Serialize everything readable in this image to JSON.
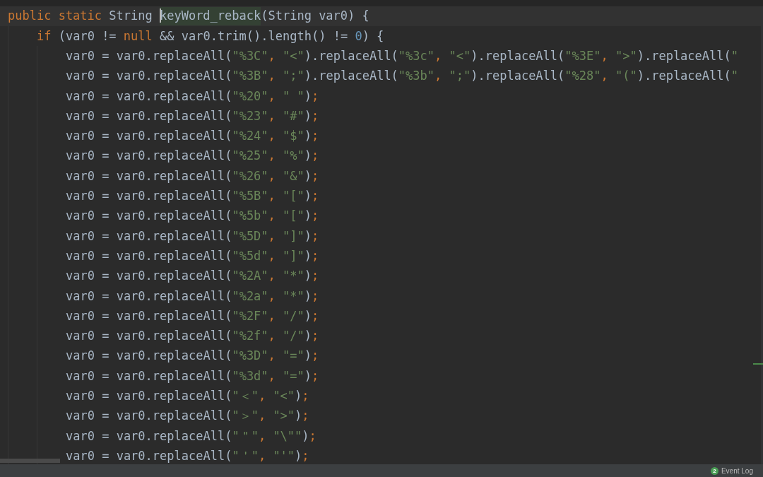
{
  "editor": {
    "lines": [
      {
        "segments": [
          {
            "kind": "keyword",
            "text": "public static "
          },
          {
            "kind": "plain",
            "text": "String "
          },
          {
            "kind": "match",
            "text": "keyWord_reback",
            "caret": true
          },
          {
            "kind": "plain",
            "text": "(String var0) {"
          }
        ],
        "children": [
          {
            "segments": [
              {
                "kind": "keyword",
                "text": "if "
              },
              {
                "kind": "plain",
                "text": "(var0 != "
              },
              {
                "kind": "keyword",
                "text": "null "
              },
              {
                "kind": "plain",
                "text": "&& var0.trim().length() != "
              },
              {
                "kind": "number",
                "text": "0"
              },
              {
                "kind": "plain",
                "text": ") {"
              }
            ],
            "children": [
              {
                "segments": [
                  {
                    "kind": "plain",
                    "text": "var0 = var0.replaceAll("
                  },
                  {
                    "kind": "string",
                    "text": "\"%3C\""
                  },
                  {
                    "kind": "punct",
                    "text": ", "
                  },
                  {
                    "kind": "string",
                    "text": "\"<\""
                  },
                  {
                    "kind": "plain",
                    "text": ").replaceAll("
                  },
                  {
                    "kind": "string",
                    "text": "\"%3c\""
                  },
                  {
                    "kind": "punct",
                    "text": ", "
                  },
                  {
                    "kind": "string",
                    "text": "\"<\""
                  },
                  {
                    "kind": "plain",
                    "text": ").replaceAll("
                  },
                  {
                    "kind": "string",
                    "text": "\"%3E\""
                  },
                  {
                    "kind": "punct",
                    "text": ", "
                  },
                  {
                    "kind": "string",
                    "text": "\">\""
                  },
                  {
                    "kind": "plain",
                    "text": ").replaceAll("
                  },
                  {
                    "kind": "string",
                    "text": "\""
                  }
                ]
              },
              {
                "segments": [
                  {
                    "kind": "plain",
                    "text": "var0 = var0.replaceAll("
                  },
                  {
                    "kind": "string",
                    "text": "\"%3B\""
                  },
                  {
                    "kind": "punct",
                    "text": ", "
                  },
                  {
                    "kind": "string",
                    "text": "\";\""
                  },
                  {
                    "kind": "plain",
                    "text": ").replaceAll("
                  },
                  {
                    "kind": "string",
                    "text": "\"%3b\""
                  },
                  {
                    "kind": "punct",
                    "text": ", "
                  },
                  {
                    "kind": "string",
                    "text": "\";\""
                  },
                  {
                    "kind": "plain",
                    "text": ").replaceAll("
                  },
                  {
                    "kind": "string",
                    "text": "\"%28\""
                  },
                  {
                    "kind": "punct",
                    "text": ", "
                  },
                  {
                    "kind": "string",
                    "text": "\"(\""
                  },
                  {
                    "kind": "plain",
                    "text": ").replaceAll("
                  },
                  {
                    "kind": "string",
                    "text": "\""
                  }
                ]
              },
              {
                "segments": [
                  {
                    "kind": "plain",
                    "text": "var0 = var0.replaceAll("
                  },
                  {
                    "kind": "string",
                    "text": "\"%20\""
                  },
                  {
                    "kind": "punct",
                    "text": ", "
                  },
                  {
                    "kind": "string",
                    "text": "\" \""
                  },
                  {
                    "kind": "plain",
                    "text": ")"
                  },
                  {
                    "kind": "punct",
                    "text": ";"
                  }
                ]
              },
              {
                "segments": [
                  {
                    "kind": "plain",
                    "text": "var0 = var0.replaceAll("
                  },
                  {
                    "kind": "string",
                    "text": "\"%23\""
                  },
                  {
                    "kind": "punct",
                    "text": ", "
                  },
                  {
                    "kind": "string",
                    "text": "\"#\""
                  },
                  {
                    "kind": "plain",
                    "text": ")"
                  },
                  {
                    "kind": "punct",
                    "text": ";"
                  }
                ]
              },
              {
                "segments": [
                  {
                    "kind": "plain",
                    "text": "var0 = var0.replaceAll("
                  },
                  {
                    "kind": "string",
                    "text": "\"%24\""
                  },
                  {
                    "kind": "punct",
                    "text": ", "
                  },
                  {
                    "kind": "string",
                    "text": "\"$\""
                  },
                  {
                    "kind": "plain",
                    "text": ")"
                  },
                  {
                    "kind": "punct",
                    "text": ";"
                  }
                ]
              },
              {
                "segments": [
                  {
                    "kind": "plain",
                    "text": "var0 = var0.replaceAll("
                  },
                  {
                    "kind": "string",
                    "text": "\"%25\""
                  },
                  {
                    "kind": "punct",
                    "text": ", "
                  },
                  {
                    "kind": "string",
                    "text": "\"%\""
                  },
                  {
                    "kind": "plain",
                    "text": ")"
                  },
                  {
                    "kind": "punct",
                    "text": ";"
                  }
                ]
              },
              {
                "segments": [
                  {
                    "kind": "plain",
                    "text": "var0 = var0.replaceAll("
                  },
                  {
                    "kind": "string",
                    "text": "\"%26\""
                  },
                  {
                    "kind": "punct",
                    "text": ", "
                  },
                  {
                    "kind": "string",
                    "text": "\"&\""
                  },
                  {
                    "kind": "plain",
                    "text": ")"
                  },
                  {
                    "kind": "punct",
                    "text": ";"
                  }
                ]
              },
              {
                "segments": [
                  {
                    "kind": "plain",
                    "text": "var0 = var0.replaceAll("
                  },
                  {
                    "kind": "string",
                    "text": "\"%5B\""
                  },
                  {
                    "kind": "punct",
                    "text": ", "
                  },
                  {
                    "kind": "string",
                    "text": "\"[\""
                  },
                  {
                    "kind": "plain",
                    "text": ")"
                  },
                  {
                    "kind": "punct",
                    "text": ";"
                  }
                ]
              },
              {
                "segments": [
                  {
                    "kind": "plain",
                    "text": "var0 = var0.replaceAll("
                  },
                  {
                    "kind": "string",
                    "text": "\"%5b\""
                  },
                  {
                    "kind": "punct",
                    "text": ", "
                  },
                  {
                    "kind": "string",
                    "text": "\"[\""
                  },
                  {
                    "kind": "plain",
                    "text": ")"
                  },
                  {
                    "kind": "punct",
                    "text": ";"
                  }
                ]
              },
              {
                "segments": [
                  {
                    "kind": "plain",
                    "text": "var0 = var0.replaceAll("
                  },
                  {
                    "kind": "string",
                    "text": "\"%5D\""
                  },
                  {
                    "kind": "punct",
                    "text": ", "
                  },
                  {
                    "kind": "string",
                    "text": "\"]\""
                  },
                  {
                    "kind": "plain",
                    "text": ")"
                  },
                  {
                    "kind": "punct",
                    "text": ";"
                  }
                ]
              },
              {
                "segments": [
                  {
                    "kind": "plain",
                    "text": "var0 = var0.replaceAll("
                  },
                  {
                    "kind": "string",
                    "text": "\"%5d\""
                  },
                  {
                    "kind": "punct",
                    "text": ", "
                  },
                  {
                    "kind": "string",
                    "text": "\"]\""
                  },
                  {
                    "kind": "plain",
                    "text": ")"
                  },
                  {
                    "kind": "punct",
                    "text": ";"
                  }
                ]
              },
              {
                "segments": [
                  {
                    "kind": "plain",
                    "text": "var0 = var0.replaceAll("
                  },
                  {
                    "kind": "string",
                    "text": "\"%2A\""
                  },
                  {
                    "kind": "punct",
                    "text": ", "
                  },
                  {
                    "kind": "string",
                    "text": "\"*\""
                  },
                  {
                    "kind": "plain",
                    "text": ")"
                  },
                  {
                    "kind": "punct",
                    "text": ";"
                  }
                ]
              },
              {
                "segments": [
                  {
                    "kind": "plain",
                    "text": "var0 = var0.replaceAll("
                  },
                  {
                    "kind": "string",
                    "text": "\"%2a\""
                  },
                  {
                    "kind": "punct",
                    "text": ", "
                  },
                  {
                    "kind": "string",
                    "text": "\"*\""
                  },
                  {
                    "kind": "plain",
                    "text": ")"
                  },
                  {
                    "kind": "punct",
                    "text": ";"
                  }
                ]
              },
              {
                "segments": [
                  {
                    "kind": "plain",
                    "text": "var0 = var0.replaceAll("
                  },
                  {
                    "kind": "string",
                    "text": "\"%2F\""
                  },
                  {
                    "kind": "punct",
                    "text": ", "
                  },
                  {
                    "kind": "string",
                    "text": "\"/\""
                  },
                  {
                    "kind": "plain",
                    "text": ")"
                  },
                  {
                    "kind": "punct",
                    "text": ";"
                  }
                ]
              },
              {
                "segments": [
                  {
                    "kind": "plain",
                    "text": "var0 = var0.replaceAll("
                  },
                  {
                    "kind": "string",
                    "text": "\"%2f\""
                  },
                  {
                    "kind": "punct",
                    "text": ", "
                  },
                  {
                    "kind": "string",
                    "text": "\"/\""
                  },
                  {
                    "kind": "plain",
                    "text": ")"
                  },
                  {
                    "kind": "punct",
                    "text": ";"
                  }
                ]
              },
              {
                "segments": [
                  {
                    "kind": "plain",
                    "text": "var0 = var0.replaceAll("
                  },
                  {
                    "kind": "string",
                    "text": "\"%3D\""
                  },
                  {
                    "kind": "punct",
                    "text": ", "
                  },
                  {
                    "kind": "string",
                    "text": "\"=\""
                  },
                  {
                    "kind": "plain",
                    "text": ")"
                  },
                  {
                    "kind": "punct",
                    "text": ";"
                  }
                ]
              },
              {
                "segments": [
                  {
                    "kind": "plain",
                    "text": "var0 = var0.replaceAll("
                  },
                  {
                    "kind": "string",
                    "text": "\"%3d\""
                  },
                  {
                    "kind": "punct",
                    "text": ", "
                  },
                  {
                    "kind": "string",
                    "text": "\"=\""
                  },
                  {
                    "kind": "plain",
                    "text": ")"
                  },
                  {
                    "kind": "punct",
                    "text": ";"
                  }
                ]
              },
              {
                "segments": [
                  {
                    "kind": "plain",
                    "text": "var0 = var0.replaceAll("
                  },
                  {
                    "kind": "string",
                    "text": "\"＜\""
                  },
                  {
                    "kind": "punct",
                    "text": ", "
                  },
                  {
                    "kind": "string",
                    "text": "\"<\""
                  },
                  {
                    "kind": "plain",
                    "text": ")"
                  },
                  {
                    "kind": "punct",
                    "text": ";"
                  }
                ]
              },
              {
                "segments": [
                  {
                    "kind": "plain",
                    "text": "var0 = var0.replaceAll("
                  },
                  {
                    "kind": "string",
                    "text": "\"＞\""
                  },
                  {
                    "kind": "punct",
                    "text": ", "
                  },
                  {
                    "kind": "string",
                    "text": "\">\""
                  },
                  {
                    "kind": "plain",
                    "text": ")"
                  },
                  {
                    "kind": "punct",
                    "text": ";"
                  }
                ]
              },
              {
                "segments": [
                  {
                    "kind": "plain",
                    "text": "var0 = var0.replaceAll("
                  },
                  {
                    "kind": "string",
                    "text": "\"＂\""
                  },
                  {
                    "kind": "punct",
                    "text": ", "
                  },
                  {
                    "kind": "string",
                    "text": "\"\\\"\""
                  },
                  {
                    "kind": "plain",
                    "text": ")"
                  },
                  {
                    "kind": "punct",
                    "text": ";"
                  }
                ]
              },
              {
                "segments": [
                  {
                    "kind": "plain",
                    "text": "var0 = var0.replaceAll("
                  },
                  {
                    "kind": "string",
                    "text": "\"＇\""
                  },
                  {
                    "kind": "punct",
                    "text": ", "
                  },
                  {
                    "kind": "string",
                    "text": "\"'\""
                  },
                  {
                    "kind": "plain",
                    "text": ")"
                  },
                  {
                    "kind": "punct",
                    "text": ";"
                  }
                ]
              }
            ]
          }
        ]
      }
    ]
  },
  "status_bar": {
    "event_log": {
      "count": "2",
      "label": "Event Log"
    }
  }
}
